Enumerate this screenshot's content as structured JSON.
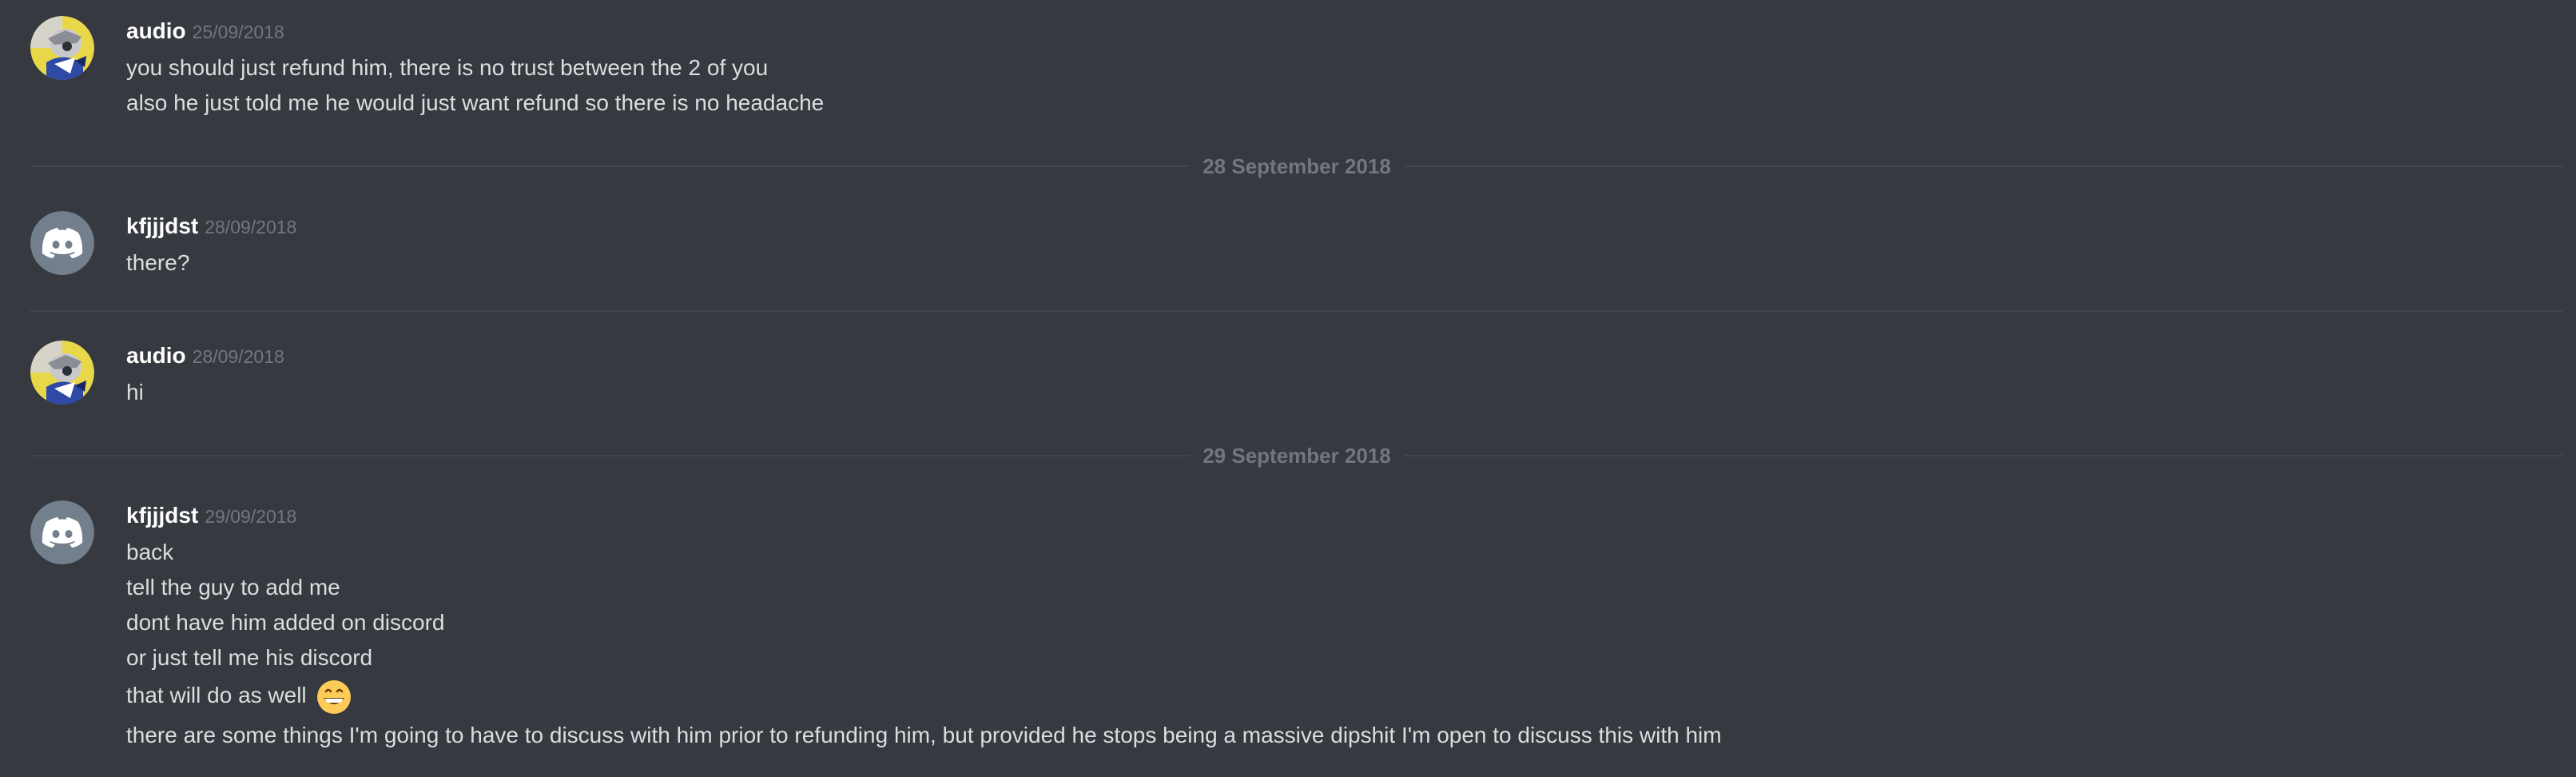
{
  "messages": [
    {
      "username": "audio",
      "timestamp": "25/09/2018",
      "avatar": "user-photo-avatar",
      "lines": [
        "you should just refund him, there is no trust between the 2 of you",
        "also he just told me he would just want refund so there is no headache"
      ]
    },
    {
      "date_divider": "28 September 2018"
    },
    {
      "username": "kfjjjdst",
      "timestamp": "28/09/2018",
      "avatar": "discord-default-avatar",
      "lines": [
        "there?"
      ]
    },
    {
      "username": "audio",
      "timestamp": "28/09/2018",
      "avatar": "user-photo-avatar",
      "lines": [
        "hi"
      ]
    },
    {
      "date_divider": "29 September 2018"
    },
    {
      "username": "kfjjjdst",
      "timestamp": "29/09/2018",
      "avatar": "discord-default-avatar",
      "lines": [
        "back",
        "tell the guy to add me",
        "dont have him added on discord",
        "or just tell me his discord",
        "that will do as well",
        "there are some things I'm going to have to discuss with him prior to refunding him, but provided he stops being a massive dipshit I'm open to discuss this with him"
      ],
      "emoji": "grinning-smile-emoji"
    }
  ],
  "colors": {
    "background": "#36393f",
    "text": "#dcddde",
    "username": "#ffffff",
    "timestamp": "#72767d",
    "divider": "#42454a",
    "discord_avatar_bg": "#747f8d"
  }
}
